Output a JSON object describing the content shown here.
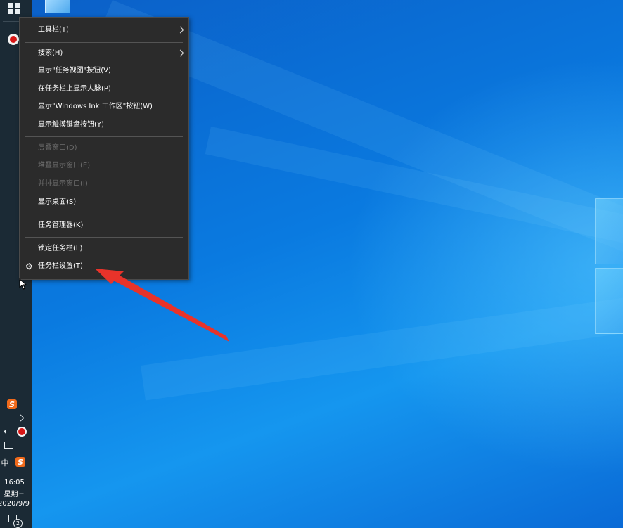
{
  "context_menu": {
    "items": [
      {
        "label": "工具栏(T)",
        "submenu": true,
        "enabled": true
      },
      {
        "label": "搜索(H)",
        "submenu": true,
        "enabled": true
      },
      {
        "label": "显示\"任务视图\"按钮(V)",
        "enabled": true
      },
      {
        "label": "在任务栏上显示人脉(P)",
        "enabled": true
      },
      {
        "label": "显示\"Windows Ink 工作区\"按钮(W)",
        "enabled": true
      },
      {
        "label": "显示触摸键盘按钮(Y)",
        "enabled": true
      },
      {
        "label": "层叠窗口(D)",
        "enabled": false
      },
      {
        "label": "堆叠显示窗口(E)",
        "enabled": false
      },
      {
        "label": "并排显示窗口(I)",
        "enabled": false
      },
      {
        "label": "显示桌面(S)",
        "enabled": true
      },
      {
        "label": "任务管理器(K)",
        "enabled": true
      },
      {
        "label": "锁定任务栏(L)",
        "enabled": true
      },
      {
        "label": "任务栏设置(T)",
        "enabled": true,
        "icon": "gear-icon"
      }
    ]
  },
  "taskbar": {
    "ime_label": "中",
    "sogou_label": "S",
    "clock_time": "16:05",
    "clock_weekday": "星期三",
    "clock_date": "2020/9/9",
    "notification_count": "2"
  },
  "colors": {
    "taskbar_bg": "#1b2a35",
    "menu_bg": "#2b2b2b",
    "annotation_arrow": "#e8332a"
  }
}
